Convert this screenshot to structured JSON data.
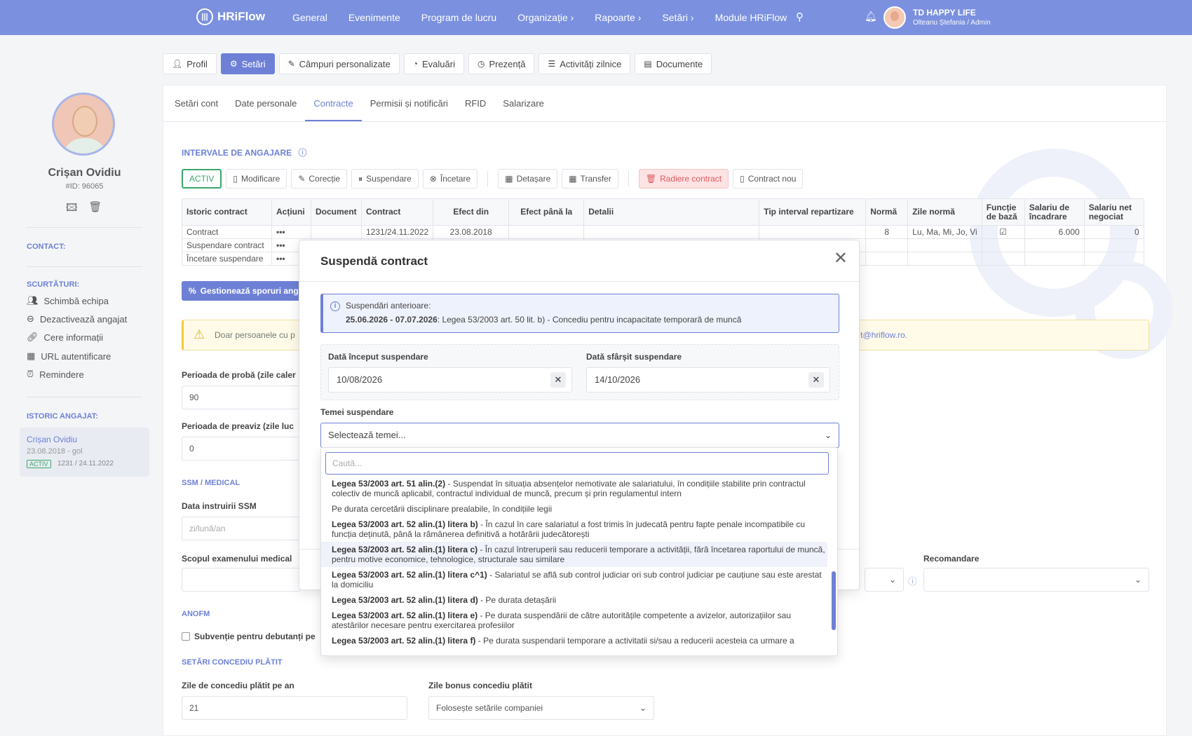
{
  "nav": {
    "brand": "HRiFlow",
    "items": [
      "General",
      "Evenimente",
      "Program de lucru",
      "Organizație ›",
      "Rapoarte ›",
      "Setări ›",
      "Module HRiFlow"
    ],
    "company": "TD HAPPY LIFE",
    "user": "Olteanu Ștefania / Admin"
  },
  "tabs": {
    "profil": "Profil",
    "setari": "Setări",
    "campuri": "Câmpuri personalizate",
    "evaluari": "Evaluări",
    "prezenta": "Prezență",
    "activitati": "Activități zilnice",
    "documente": "Documente"
  },
  "sidebar": {
    "name": "Crișan Ovidiu",
    "id": "#ID: 96065",
    "contact_heading": "CONTACT:",
    "shortcuts_heading": "SCURTĂTURI:",
    "shortcuts": [
      "Schimbă echipa",
      "Dezactivează angajat",
      "Cere informații",
      "URL autentificare",
      "Remindere"
    ],
    "history_heading": "ISTORIC ANGAJAT:",
    "history": {
      "name": "Crișan Ovidiu",
      "period": "23.08.2018 - gol",
      "badge": "ACTIV",
      "contract": "1231 / 24.11.2022"
    }
  },
  "subtabs": [
    "Setări cont",
    "Date personale",
    "Contracte",
    "Permisii și notificări",
    "RFID",
    "Salarizare"
  ],
  "intervals": {
    "title": "INTERVALE DE ANGAJARE",
    "status": "ACTIV",
    "buttons": {
      "modificare": "Modificare",
      "corectie": "Corecție",
      "suspendare": "Suspendare",
      "incetare": "Încetare",
      "detasare": "Detașare",
      "transfer": "Transfer",
      "radiere": "Radiere contract",
      "nou": "Contract nou"
    },
    "columns": [
      "Istoric contract",
      "Acțiuni",
      "Document",
      "Contract",
      "Efect din",
      "Efect până la",
      "Detalii",
      "Tip interval repartizare",
      "Normă",
      "Zile normă",
      "Funcție de bază",
      "Salariu de încadrare",
      "Salariu net negociat"
    ],
    "rows": [
      {
        "istoric": "Contract",
        "actiuni": "•••",
        "document": "",
        "contract": "1231/24.11.2022",
        "efect_din": "23.08.2018",
        "norma": "8",
        "zile": "Lu, Ma, Mi, Jo, Vi",
        "functie": "☑",
        "salariu": "6.000",
        "net": "0"
      },
      {
        "istoric": "Suspendare contract",
        "actiuni": "•••"
      },
      {
        "istoric": "Încetare suspendare",
        "actiuni": "•••"
      }
    ],
    "manage_button": "Gestionează sporuri angajat"
  },
  "warning": {
    "text": "Doar persoanele cu p",
    "email": "t@hriflow.ro."
  },
  "form": {
    "proba_label": "Perioada de probă (zile caler",
    "proba_value": "90",
    "preaviz_label": "Perioada de preaviz (zile luc",
    "preaviz_value": "0",
    "ssm_title": "SSM / MEDICAL",
    "ssm_date_label": "Data instruirii SSM",
    "ssm_date_placeholder": "zi/lună/an",
    "scop_label": "Scopul examenului medical",
    "recomandare_label": "Recomandare",
    "anofm_title": "ANOFM",
    "subventie_label": "Subvenție pentru debutanți pe",
    "concediu_title": "SETĂRI CONCEDIU PLĂTIT",
    "zile_label": "Zile de concediu plătit pe an",
    "zile_value": "21",
    "bonus_label": "Zile bonus concediu plătit",
    "bonus_value": "Folosește setările companiei"
  },
  "modal": {
    "title": "Suspendă contract",
    "info_title": "Suspendări anterioare:",
    "info_dates": "25.06.2026 - 07.07.2026",
    "info_text": ": Legea 53/2003 art. 50 lit. b) - Concediu pentru incapacitate temporară de muncă",
    "start_label": "Dată început suspendare",
    "start_value": "10/08/2026",
    "end_label": "Dată sfârșit suspendare",
    "end_value": "14/10/2026",
    "temei_label": "Temei suspendare",
    "temei_placeholder": "Selectează temei...",
    "search_placeholder": "Caută..."
  },
  "dropdown": [
    {
      "bold": "Legea 53/2003 art. 51 alin.(2)",
      "text": " - Suspendat în situația absențelor nemotivate ale salariatului, în condițiile stabilite prin contractul colectiv de muncă aplicabil, contractul individual de muncă, precum și prin regulamentul intern"
    },
    {
      "bold": "",
      "text": "Pe durata cercetării disciplinare prealabile, în condițiile legii"
    },
    {
      "bold": "Legea 53/2003 art. 52 alin.(1) litera b)",
      "text": " - În cazul în care salariatul a fost trimis în judecată pentru fapte penale incompatibile cu funcția deținută, până la rămânerea definitivă a hotărârii judecătorești"
    },
    {
      "bold": "Legea 53/2003 art. 52 alin.(1) litera c)",
      "text": " - În cazul întreruperii sau reducerii temporare a activității, fără încetarea raportului de muncă, pentru motive economice, tehnologice, structurale sau similare"
    },
    {
      "bold": "Legea 53/2003 art. 52 alin.(1) litera c^1)",
      "text": " - Salariatul se află sub control judiciar ori sub control judiciar pe cauțiune sau este arestat la domiciliu"
    },
    {
      "bold": "Legea 53/2003 art. 52 alin.(1) litera d)",
      "text": " - Pe durata detașării"
    },
    {
      "bold": "Legea 53/2003 art. 52 alin.(1) litera e)",
      "text": " - Pe durata suspendării de către autoritățile competente a avizelor, autorizațiilor sau atestărilor necesare pentru exercitarea profesiilor"
    },
    {
      "bold": "Legea 53/2003 art. 52 alin.(1) litera f)",
      "text": " - Pe durata suspendarii temporare a activitatii si/sau a reducerii acesteia ca urmare a"
    }
  ]
}
